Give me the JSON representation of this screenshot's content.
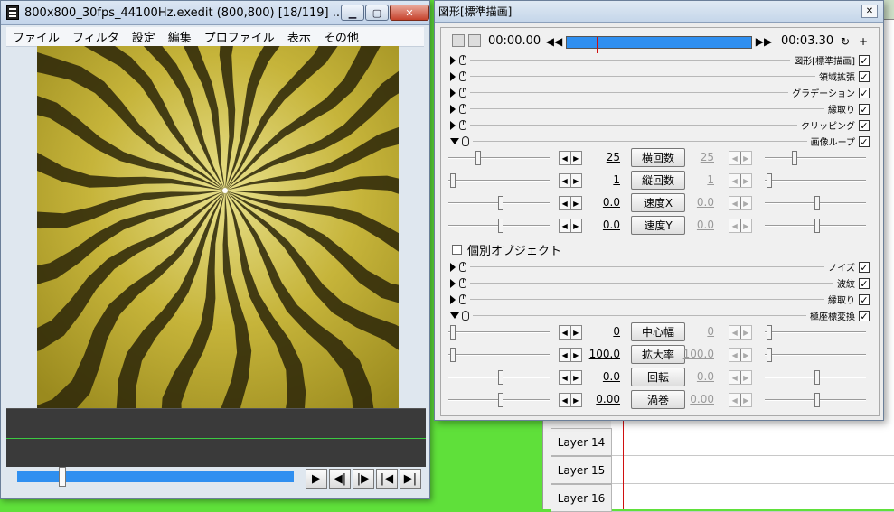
{
  "preview_window": {
    "title": "800x800_30fps_44100Hz.exedit (800,800)  [18/119]  ...",
    "menu": [
      "ファイル",
      "フィルタ",
      "設定",
      "編集",
      "プロファイル",
      "表示",
      "その他"
    ],
    "playback_buttons": [
      "▶",
      "◀|",
      "|▶",
      "|◀",
      "▶|"
    ]
  },
  "dialog": {
    "title": "図形[標準描画]",
    "time_start": "00:00.00",
    "time_end": "00:03.30",
    "filters_top": [
      {
        "name": "図形[標準描画]",
        "expanded": false,
        "checked": true
      },
      {
        "name": "領域拡張",
        "expanded": false,
        "checked": true
      },
      {
        "name": "グラデーション",
        "expanded": false,
        "checked": true
      },
      {
        "name": "縁取り",
        "expanded": false,
        "checked": true
      },
      {
        "name": "クリッピング",
        "expanded": false,
        "checked": true
      },
      {
        "name": "画像ループ",
        "expanded": true,
        "checked": true
      }
    ],
    "loop_params": [
      {
        "label": "横回数",
        "value": "25",
        "end_value": "25"
      },
      {
        "label": "縦回数",
        "value": "1",
        "end_value": "1"
      },
      {
        "label": "速度X",
        "value": "0.0",
        "end_value": "0.0"
      },
      {
        "label": "速度Y",
        "value": "0.0",
        "end_value": "0.0"
      }
    ],
    "individual_object_label": "個別オブジェクト",
    "filters_mid": [
      {
        "name": "ノイズ",
        "expanded": false,
        "checked": true
      },
      {
        "name": "波紋",
        "expanded": false,
        "checked": true
      },
      {
        "name": "縁取り",
        "expanded": false,
        "checked": true
      },
      {
        "name": "極座標変換",
        "expanded": true,
        "checked": true
      }
    ],
    "polar_params": [
      {
        "label": "中心幅",
        "value": "0",
        "end_value": "0"
      },
      {
        "label": "拡大率",
        "value": "100.0",
        "end_value": "100.0"
      },
      {
        "label": "回転",
        "value": "0.0",
        "end_value": "0.0"
      },
      {
        "label": "渦巻",
        "value": "0.00",
        "end_value": "0.00"
      }
    ]
  },
  "timeline": {
    "layers": [
      "Layer 14",
      "Layer 15",
      "Layer 16"
    ]
  }
}
